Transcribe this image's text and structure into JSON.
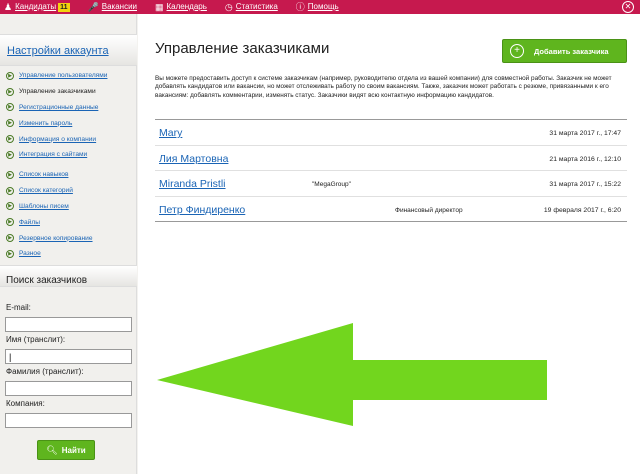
{
  "topnav": {
    "items": [
      {
        "label": "Кандидаты",
        "icon": "candidates-icon",
        "badge": "11"
      },
      {
        "label": "Вакансии",
        "icon": "microphone-icon"
      },
      {
        "label": "Календарь",
        "icon": "calendar-icon"
      },
      {
        "label": "Статистика",
        "icon": "clock-icon"
      },
      {
        "label": "Помощь",
        "icon": "help-icon"
      }
    ]
  },
  "sidebar": {
    "title": "Настройки аккаунта",
    "group1": [
      {
        "label": "Управление пользователями"
      },
      {
        "label": "Управление заказчиками"
      },
      {
        "label": "Регистрационные данные"
      },
      {
        "label": "Изменить пароль"
      },
      {
        "label": "Информация о компании"
      },
      {
        "label": "Интеграция с сайтами"
      }
    ],
    "group2": [
      {
        "label": "Список навыков"
      },
      {
        "label": "Список категорий"
      },
      {
        "label": "Шаблоны писем"
      },
      {
        "label": "Файлы"
      },
      {
        "label": "Резервное копирование"
      },
      {
        "label": "Разное"
      }
    ]
  },
  "search": {
    "title": "Поиск заказчиков",
    "email_label": "E-mail:",
    "email_value": "",
    "first_name_label": "Имя (транслит):",
    "first_name_value": "|",
    "last_name_label": "Фамилия (транслит):",
    "last_name_value": "",
    "company_label": "Компания:",
    "company_value": "",
    "button_label": "Найти"
  },
  "main": {
    "title": "Управление заказчиками",
    "add_button": "Добавить заказчика",
    "description": "Вы можете предоставить доступ к системе заказчикам (например, руководителю отдела из вашей компании) для совместной работы. Заказчик не может добавлять кандидатов или вакансии, но может отслеживать работу по своим вакансиям. Также, заказчик может работать с резюме, привязанными к его вакансиям: добавлять комментарии, изменять статус. Заказчики видят всю контактную информацию кандидатов.",
    "clients": [
      {
        "name": "Mary",
        "company": "",
        "position": "",
        "date": "31 марта 2017 г., 17:47"
      },
      {
        "name": "Лия Мартовна",
        "company": "",
        "position": "",
        "date": "21 марта 2016 г., 12:10"
      },
      {
        "name": "Miranda Pristli",
        "company": "\"MegaGroup\"",
        "position": "",
        "date": "31 марта 2017 г., 15:22"
      },
      {
        "name": "Петр Финдиренко",
        "company": "",
        "position": "Финансовый директор",
        "date": "19 февраля 2017 г., 6:20"
      }
    ]
  },
  "colors": {
    "topbar": "#c6194e",
    "accent_green": "#5fb51e",
    "arrow_green": "#72d61e",
    "link_blue": "#1a64b5"
  }
}
